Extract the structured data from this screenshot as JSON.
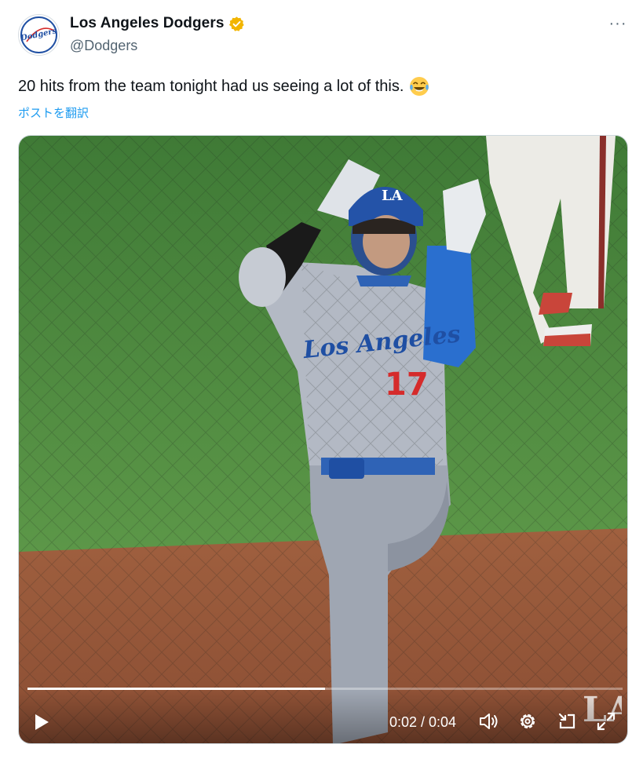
{
  "author": {
    "display_name": "Los Angeles Dodgers",
    "handle": "@Dodgers",
    "avatar_text": "Dodgers",
    "verified": true,
    "verified_color": "#f2b500"
  },
  "tweet": {
    "text": "20 hits from the team tonight had us seeing a lot of this.",
    "emoji": "face-with-tears-of-joy",
    "translate_label": "ポストを翻訳"
  },
  "menu": {
    "more_label": "···"
  },
  "video": {
    "time_display": "0:02 / 0:04",
    "progress": 0.5,
    "watermark": "LA",
    "jersey_text": "Los Angeles",
    "jersey_number": "17"
  },
  "colors": {
    "accent": "#1d9bf0",
    "text_primary": "#0f1419",
    "text_secondary": "#536471",
    "dodger_blue": "#1f4fa3",
    "field_green": "#4f8a3d",
    "dirt": "#9a5a3e"
  }
}
